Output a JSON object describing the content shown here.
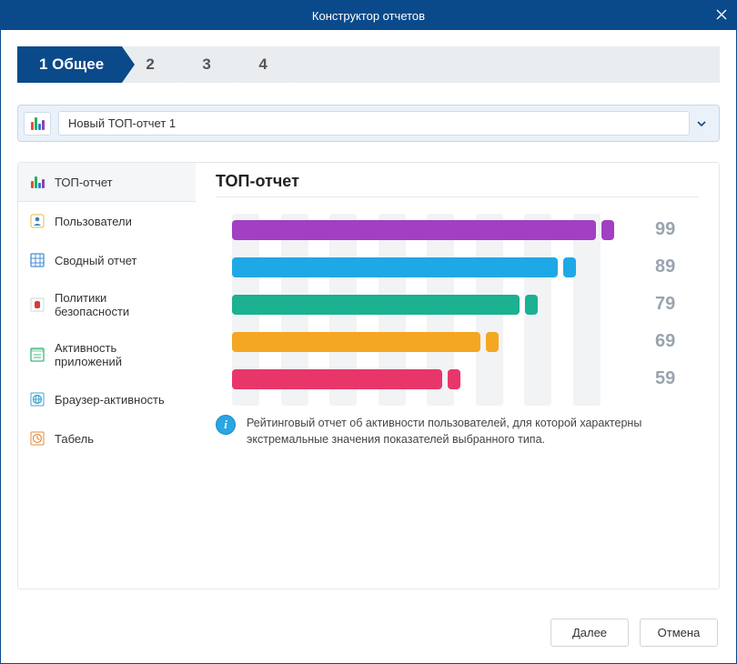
{
  "window": {
    "title": "Конструктор отчетов"
  },
  "stepper": {
    "active_index": 0,
    "steps": [
      "1 Общее",
      "2",
      "3",
      "4"
    ]
  },
  "report_select": {
    "name": "Новый ТОП-отчет 1"
  },
  "sidebar": {
    "selected_index": 0,
    "items": [
      {
        "label": "ТОП-отчет"
      },
      {
        "label": "Пользователи"
      },
      {
        "label": "Сводный отчет"
      },
      {
        "label": "Политики безопасности"
      },
      {
        "label": "Активность приложений"
      },
      {
        "label": "Браузер-активность"
      },
      {
        "label": "Табель"
      }
    ]
  },
  "detail": {
    "title": "ТОП-отчет",
    "description": "Рейтинговый отчет об активности пользователей, для которой характерны экстремальные значения показателей выбранного типа."
  },
  "chart_data": {
    "type": "bar",
    "orientation": "horizontal",
    "categories": [
      "",
      "",
      "",
      "",
      ""
    ],
    "series": [
      {
        "name": "main",
        "values": [
          99,
          89,
          79,
          69,
          59
        ],
        "colors": [
          "#a23fc2",
          "#1fa8e6",
          "#1bb191",
          "#f4a722",
          "#e8366b"
        ]
      }
    ],
    "xlim": [
      0,
      100
    ]
  },
  "footer": {
    "next_label": "Далее",
    "cancel_label": "Отмена"
  }
}
